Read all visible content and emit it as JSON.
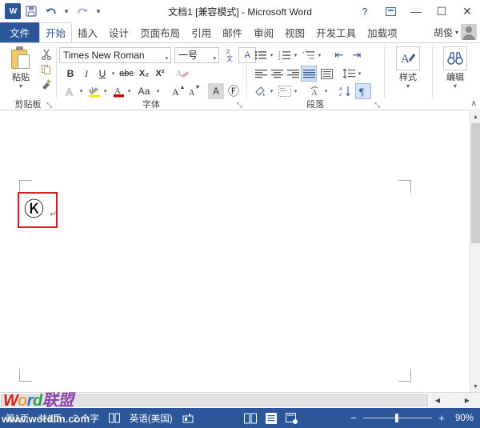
{
  "window": {
    "title": "文档1 [兼容模式] - Microsoft Word",
    "logo_text": "W",
    "quick_access": [
      {
        "name": "save",
        "glyph": "■",
        "label": "保存"
      },
      {
        "name": "undo",
        "glyph": "↶",
        "label": "撤消"
      },
      {
        "name": "redo",
        "glyph": "↻",
        "label": "恢复"
      },
      {
        "name": "customize",
        "glyph": "▾",
        "label": "自定义快速访问工具栏"
      }
    ],
    "controls": {
      "help": "?",
      "ribbon_display": "⊡",
      "minimize": "—",
      "maximize": "☐",
      "close": "✕"
    }
  },
  "tabs": {
    "file": "文件",
    "items": [
      {
        "label": "开始",
        "active": true
      },
      {
        "label": "插入",
        "active": false
      },
      {
        "label": "设计",
        "active": false
      },
      {
        "label": "页面布局",
        "active": false
      },
      {
        "label": "引用",
        "active": false
      },
      {
        "label": "邮件",
        "active": false
      },
      {
        "label": "审阅",
        "active": false
      },
      {
        "label": "视图",
        "active": false
      },
      {
        "label": "开发工具",
        "active": false
      },
      {
        "label": "加载项",
        "active": false
      }
    ],
    "user": "胡俊",
    "user_caret": "▾"
  },
  "ribbon": {
    "groups": {
      "clipboard": {
        "label": "剪贴板",
        "paste_label": "粘贴",
        "paste_caret": "▾",
        "cut": "✂",
        "copy": "❐",
        "format_painter": "✒",
        "launcher": "⤡"
      },
      "font": {
        "label": "字体",
        "font_name": "Times New Roman",
        "font_size": "一号",
        "dropdown_caret": "▾",
        "phonetic_guide": "拼音",
        "char_border": "A",
        "bold": "B",
        "italic": "I",
        "underline": "U",
        "strikethrough": "abc",
        "subscript": "X₂",
        "superscript": "X²",
        "clear_format": "A",
        "text_effects": "A",
        "highlight": "ab",
        "font_color": "A",
        "change_case": "Aa",
        "grow_font": "A",
        "shrink_font": "A",
        "char_shading": "A",
        "enclose_char": "Ⓕ",
        "launcher": "⤡"
      },
      "paragraph": {
        "label": "段落",
        "bullets": "≡",
        "numbering": "≡",
        "multilevel": "≡",
        "decrease_indent": "⇤",
        "increase_indent": "⇥",
        "align_left": "≡",
        "align_center": "≡",
        "align_right": "≡",
        "justify": "≡",
        "distributed": "≡",
        "line_spacing": "↕",
        "shading": "▣",
        "borders": "⊞",
        "asian_layout": "文",
        "sort": "A↓",
        "show_marks": "¶",
        "launcher": "⤡"
      },
      "styles": {
        "label": "样式",
        "caret": "▾",
        "icon": "A"
      },
      "editing": {
        "label": "编辑",
        "caret": "▾",
        "icon": "⌕"
      }
    },
    "collapse": "∧"
  },
  "document": {
    "content_char": "Ⓚ",
    "paragraph_mark": "↵",
    "selection_color": "#d81f1f"
  },
  "scroll": {
    "up_arrow": "▲",
    "down_arrow": "▼",
    "left_arrow": "◀",
    "right_arrow": "▶"
  },
  "status": {
    "page_info": "第1页，共1页",
    "word_count": "2 个字",
    "proofing_icon": "⧉",
    "language": "英语(美国)",
    "macro_icon": "▤",
    "views": [
      {
        "name": "read-mode",
        "glyph": "◫",
        "selected": false
      },
      {
        "name": "print-layout",
        "glyph": "▤",
        "selected": true
      },
      {
        "name": "web-layout",
        "glyph": "▥",
        "selected": false
      }
    ],
    "zoom_out": "−",
    "zoom_in": "+",
    "zoom_level": "90%"
  },
  "watermark": {
    "brand_parts": [
      "W",
      "o",
      "r",
      "d",
      "联",
      "盟"
    ],
    "url": "www.wordlm.com"
  },
  "colors": {
    "accent": "#2b579a",
    "file_tab": "#2b579a",
    "selection_red": "#d81f1f",
    "canvas_gray": "#7e7e7e"
  }
}
